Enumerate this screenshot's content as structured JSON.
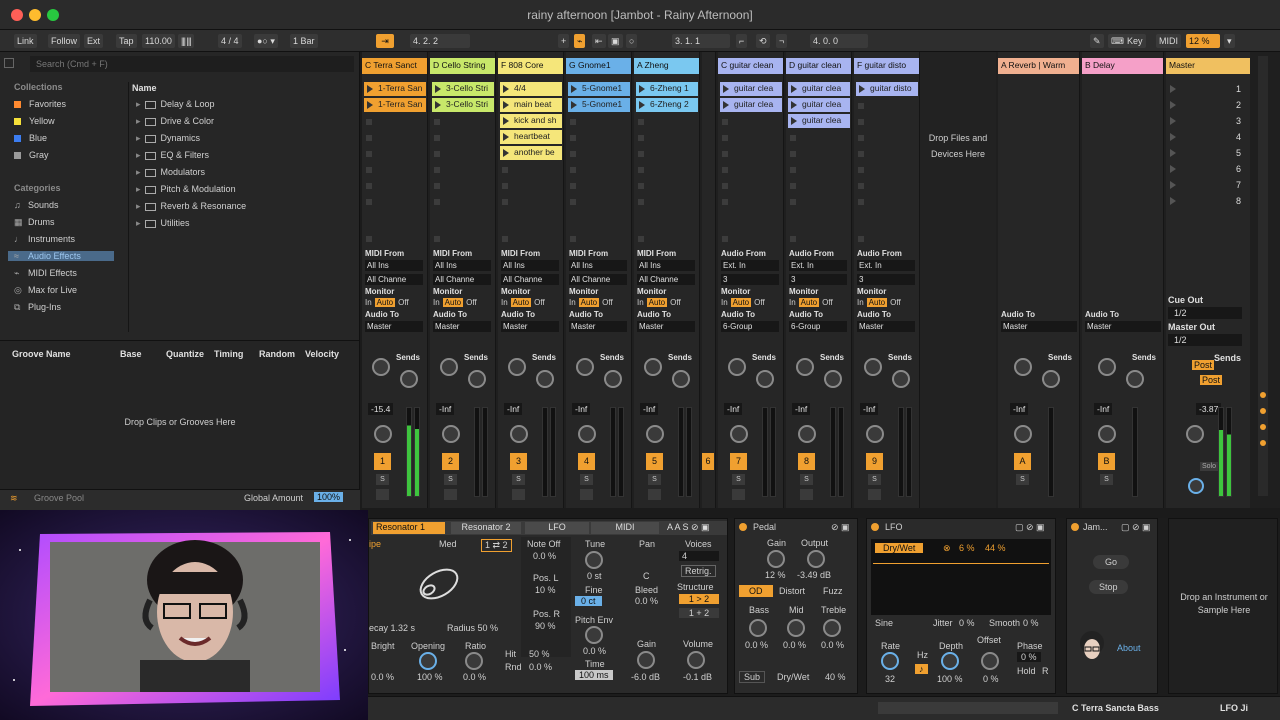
{
  "window": {
    "title": "rainy afternoon  [Jambot - Rainy Afternoon]"
  },
  "controlbar": {
    "link": "Link",
    "follow": "Follow",
    "ext": "Ext",
    "tap": "Tap",
    "tempo": "110.00",
    "sig": "4 / 4",
    "quant": "1 Bar",
    "position": "4.   2.   2",
    "loop_start": "3.   1.   1",
    "loop_len": "4.   0.   0",
    "key": "Key",
    "midi": "MIDI",
    "cpu": "12 %"
  },
  "browser": {
    "search_placeholder": "Search (Cmd + F)",
    "collections_label": "Collections",
    "collections": [
      {
        "label": "Favorites",
        "color": "#ff8a30"
      },
      {
        "label": "Yellow",
        "color": "#f5e03a"
      },
      {
        "label": "Blue",
        "color": "#3c7df0"
      },
      {
        "label": "Gray",
        "color": "#9a9a9a"
      }
    ],
    "categories_label": "Categories",
    "categories": [
      "Sounds",
      "Drums",
      "Instruments",
      "Audio Effects",
      "MIDI Effects",
      "Max for Live",
      "Plug-Ins"
    ],
    "name_header": "Name",
    "folders": [
      "Delay & Loop",
      "Drive & Color",
      "Dynamics",
      "EQ & Filters",
      "Modulators",
      "Pitch & Modulation",
      "Reverb & Resonance",
      "Utilities"
    ]
  },
  "groove": {
    "cols": [
      "Groove Name",
      "Base",
      "Quantize",
      "Timing",
      "Random",
      "Velocity"
    ],
    "drop": "Drop Clips or Grooves Here",
    "pool": "Groove Pool",
    "global_amount": "Global Amount",
    "global_value": "100%"
  },
  "tracks": [
    {
      "name": "C Terra Sanct",
      "color": "#f0a030",
      "clips": [
        "1-Terra San",
        "1-Terra San"
      ],
      "io_label": "MIDI From",
      "io_from": "All Ins",
      "chan": "All Channe",
      "vol": "-15.4",
      "num": "1"
    },
    {
      "name": "D Cello String",
      "color": "#c8e86a",
      "clips": [
        "3-Cello Stri",
        "3-Cello Stri"
      ],
      "io_label": "MIDI From",
      "io_from": "All Ins",
      "chan": "All Channe",
      "vol": "-Inf",
      "num": "2"
    },
    {
      "name": "F 808 Core",
      "color": "#f5e67a",
      "clips": [
        "4/4",
        "main beat",
        "kick and sh",
        "heartbeat",
        "another be"
      ],
      "io_label": "MIDI From",
      "io_from": "All Ins",
      "chan": "All Channe",
      "vol": "-Inf",
      "num": "3"
    },
    {
      "name": "G Gnome1",
      "color": "#6ab0e8",
      "clips": [
        "5-Gnome1",
        "5-Gnome1"
      ],
      "io_label": "MIDI From",
      "io_from": "All Ins",
      "chan": "All Channe",
      "vol": "-Inf",
      "num": "4"
    },
    {
      "name": "A Zheng",
      "color": "#7ac8f0",
      "clips": [
        "6-Zheng 1",
        "6-Zheng 2"
      ],
      "io_label": "MIDI From",
      "io_from": "All Ins",
      "chan": "All Channe",
      "vol": "-Inf",
      "num": "5"
    },
    {
      "name": "C guitar clean",
      "color": "#a8b4f0",
      "clips": [
        "guitar clea",
        "guitar clea"
      ],
      "io_label": "Audio From",
      "io_from": "Ext. In",
      "chan": "3",
      "vol": "-Inf",
      "num": "7"
    },
    {
      "name": "D guitar clean",
      "color": "#a8b4f0",
      "clips": [
        "guitar clea",
        "guitar clea",
        "guitar clea"
      ],
      "io_label": "Audio From",
      "io_from": "Ext. In",
      "chan": "3",
      "vol": "-Inf",
      "num": "8"
    },
    {
      "name": "F guitar disto",
      "color": "#a8b4f0",
      "clips": [
        "guitar disto"
      ],
      "io_label": "Audio From",
      "io_from": "Ext. In",
      "chan": "3",
      "vol": "-Inf",
      "num": "9"
    }
  ],
  "returns": [
    {
      "name": "A Reverb | Warm",
      "color": "#f0b090",
      "num": "A"
    },
    {
      "name": "B Delay",
      "color": "#f5a0c8",
      "num": "B"
    }
  ],
  "master": {
    "name": "Master",
    "color": "#f0c060",
    "cue_out": "Cue Out",
    "cue_val": "1/2",
    "master_out": "Master Out",
    "master_val": "1/2",
    "vol": "-3.87",
    "scenes": [
      "1",
      "2",
      "3",
      "4",
      "5",
      "6",
      "7",
      "8"
    ]
  },
  "session": {
    "drop": "Drop Files and Devices Here",
    "sends": "Sends",
    "monitor": "Monitor",
    "audio_to": "Audio To",
    "master": "Master",
    "group": "6-Group",
    "in": "In",
    "auto": "Auto",
    "off": "Off",
    "knob_a": "A",
    "knob_b": "B",
    "solo": "S",
    "inf": "-Inf",
    "post": "Post"
  },
  "devices": {
    "resonator_tab1": "Resonator 1",
    "resonator_tab2": "Resonator 2",
    "lfo_tab": "LFO",
    "midi_tab": "MIDI",
    "type": "ipe",
    "med": "Med",
    "note_off": "Note Off",
    "note_off_val": "0.0 %",
    "pos_l": "Pos. L",
    "pos_l_val": "10 %",
    "pos_r": "Pos. R",
    "pos_r_val": "90 %",
    "decay": "ecay 1.32 s",
    "radius": "Radius 50 %",
    "tune": "Tune",
    "tune_val": "0 st",
    "fine": "Fine",
    "fine_val": "0 ct",
    "pan": "Pan",
    "pan_val": "C",
    "bleed": "Bleed",
    "bleed_val": "0.0 %",
    "voices": "Voices",
    "voices_val": "4",
    "retrig": "Retrig.",
    "structure": "Structure",
    "s1": "1 > 2",
    "s2": "1 + 2",
    "pitch_env": "Pitch Env",
    "pe_val": "0.0 %",
    "time": "Time",
    "time_val": "100 ms",
    "gain": "Gain",
    "gain_val": "-6.0 dB",
    "volume": "Volume",
    "vol_val": "-0.1 dB",
    "bright": "Bright",
    "bright_val": "0.0 %",
    "opening": "Opening",
    "opening_val": "100 %",
    "ratio": "Ratio",
    "ratio_val": "0.0 %",
    "hit": "Hit",
    "hit_val": "50 %",
    "rnd": "Rnd",
    "rnd_val": "0.0 %",
    "pedal": "Pedal",
    "p_gain": "Gain",
    "p_gain_val": "12 %",
    "p_out": "Output",
    "p_out_val": "-3.49 dB",
    "od": "OD",
    "distort": "Distort",
    "fuzz": "Fuzz",
    "bass": "Bass",
    "mid": "Mid",
    "treble": "Treble",
    "bass_val": "0.0 %",
    "mid_val": "0.0 %",
    "treble_val": "0.0 %",
    "sub": "Sub",
    "drywet": "Dry/Wet",
    "drywet_val": "40 %",
    "lfo": "LFO",
    "lfo_param": "Dry/Wet",
    "lfo_a": "6 %",
    "lfo_b": "44 %",
    "sine": "Sine",
    "jitter": "Jitter",
    "jitter_val": "0 %",
    "smooth": "Smooth",
    "smooth_val": "0 %",
    "rate": "Rate",
    "rate_val": "32",
    "hz": "Hz",
    "depth": "Depth",
    "depth_val": "100 %",
    "offset": "Offset",
    "offset_val": "0 %",
    "phase": "Phase",
    "phase_val": "0 %",
    "hold": "Hold",
    "r": "R",
    "jam": "Jam...",
    "go": "Go",
    "stop": "Stop",
    "about": "About",
    "drop_inst": "Drop an Instrument or Sample Here"
  },
  "status": {
    "track": "C Terra Sancta Bass",
    "lfo": "LFO Ji"
  }
}
